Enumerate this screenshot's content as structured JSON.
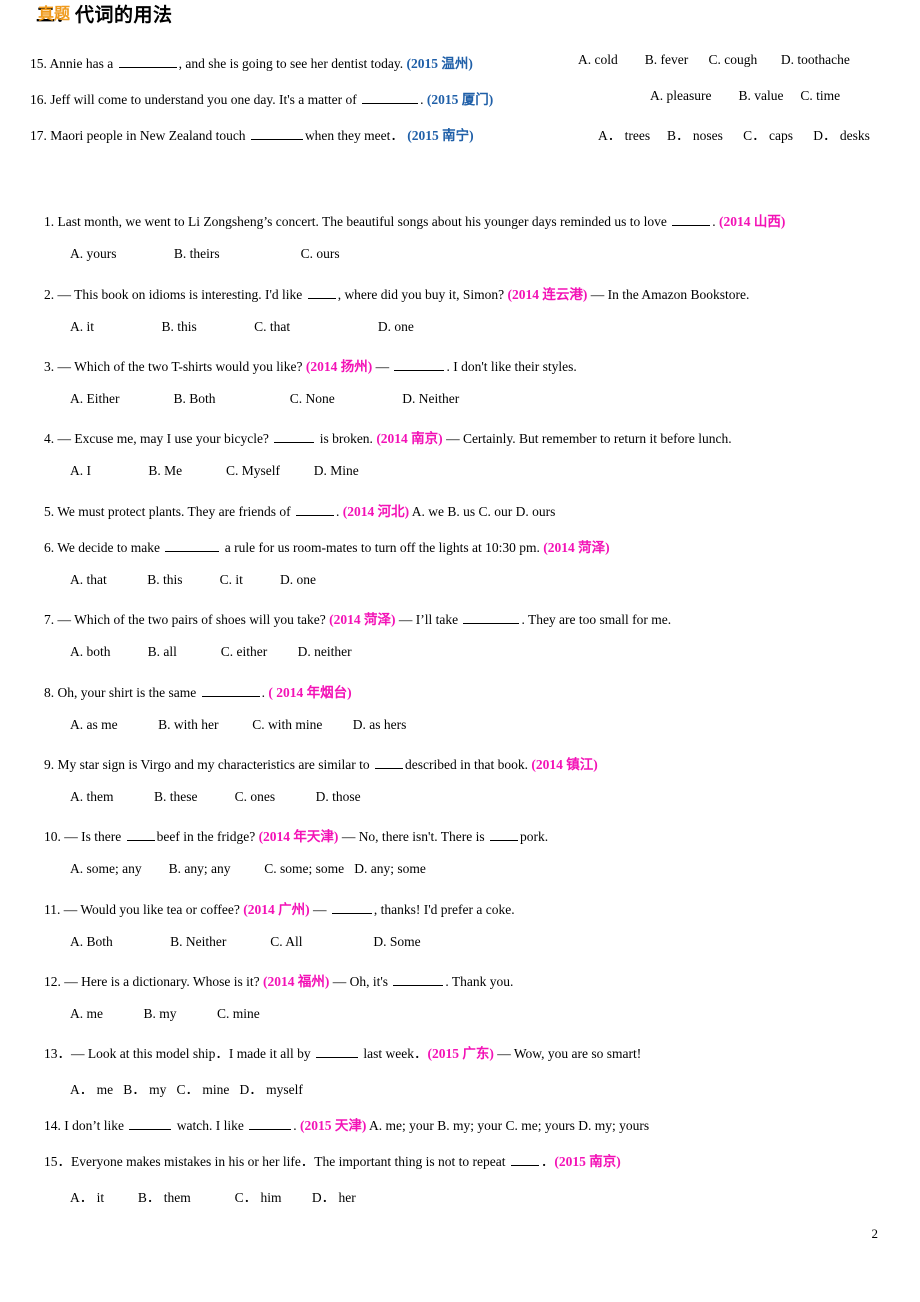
{
  "page": {
    "number": "2"
  },
  "top_section": {
    "items": [
      {
        "num": "15.",
        "stem_a": "Annie has a",
        "stem_b": ", and she is going to see her dentist today.",
        "tag": "(2015 温州)",
        "tag_color": "blue",
        "options": "A. cold        B. fever      C. cough       D. toothache",
        "blank_w": "58"
      },
      {
        "num": "16.",
        "stem_a": "Jeff will come to understand you one day. It's a matter of",
        "stem_b": ".",
        "tag": "(2015 厦门)",
        "tag_color": "blue",
        "options": "A. pleasure        B. value     C. time",
        "blank_w": "56"
      },
      {
        "num": "17.",
        "stem_a": " Maori people in New Zealand touch",
        "stem_b": "when they meet．",
        "tag": "(2015 南宁)",
        "tag_color": "blue",
        "options": "A． trees     B． noses      C． caps      D． desks",
        "blank_w": "52"
      }
    ]
  },
  "section": {
    "title": "二．代词的用法",
    "subtitle": "真题"
  },
  "questions": [
    {
      "id": "q1",
      "stem": [
        {
          "t": "1. Last month, we went to Li Zongsheng’s concert. The beautiful songs about his younger days reminded us to love "
        },
        {
          "blank": "38"
        },
        {
          "t": ". "
        },
        {
          "tag": "(2014  山西)",
          "color": "pink"
        }
      ],
      "options": "A. yours                 B. theirs                        C. ours"
    },
    {
      "id": "q2",
      "stem": [
        {
          "t": "2. — This book on idioms is interesting. I'd like "
        },
        {
          "blank": "28"
        },
        {
          "t": ", where did you buy it, Simon? "
        },
        {
          "tag": "(2014 连云港)",
          "color": "pink"
        },
        {
          "t": "        — In the Amazon Bookstore."
        }
      ],
      "options": "A. it                    B. this                 C. that                          D. one"
    },
    {
      "id": "q3",
      "stem": [
        {
          "t": "3. — Which of the two T-shirts would you like? "
        },
        {
          "tag": "(2014 扬州)",
          "color": "pink"
        },
        {
          "t": "      — "
        },
        {
          "blank": "50"
        },
        {
          "t": ". I don't like their styles."
        }
      ],
      "options": "A. Either                B. Both                      C. None                    D. Neither"
    },
    {
      "id": "q4",
      "stem": [
        {
          "t": "4. — Excuse me, may I use your bicycle? "
        },
        {
          "blank": "40"
        },
        {
          "t": " is broken. "
        },
        {
          "tag": "(2014 南京)",
          "color": "pink"
        },
        {
          "t": "     — Certainly. But remember to return it before lunch."
        }
      ],
      "options": "A. I                 B. Me             C. Myself          D. Mine"
    },
    {
      "id": "q5",
      "stem": [
        {
          "t": "5. We must protect plants. They are friends of "
        },
        {
          "blank": "38"
        },
        {
          "t": ". "
        },
        {
          "tag": "(2014 河北)",
          "color": "pink"
        },
        {
          "t": "     A. we        B. us         C. our        D. ours"
        }
      ],
      "options": ""
    },
    {
      "id": "q6",
      "stem": [
        {
          "t": "6. We decide to make "
        },
        {
          "blank": "54"
        },
        {
          "t": " a rule for us room-mates to turn off the lights at 10:30 pm. "
        },
        {
          "tag": "(2014  菏泽)",
          "color": "pink"
        }
      ],
      "options": "A. that            B. this           C. it           D. one"
    },
    {
      "id": "q7",
      "stem": [
        {
          "t": "7. — Which of the two pairs of shoes will you take? "
        },
        {
          "tag": "(2014  菏泽)",
          "color": "pink"
        },
        {
          "t": "    — I’ll take "
        },
        {
          "blank": "56"
        },
        {
          "t": ". They are too small for me."
        }
      ],
      "options": "A. both           B. all             C. either         D. neither"
    },
    {
      "id": "q8",
      "stem": [
        {
          "t": "8. Oh, your shirt is the same "
        },
        {
          "blank": "58"
        },
        {
          "t": ". "
        },
        {
          "tag": "( 2014 年烟台)",
          "color": "pink"
        }
      ],
      "options": "A. as me            B. with her          C. with mine         D. as hers"
    },
    {
      "id": "q9",
      "stem": [
        {
          "t": "9. My star sign is Virgo and my characteristics are similar to "
        },
        {
          "blank": "28"
        },
        {
          "t": "described in that book. "
        },
        {
          "tag": "(2014 镇江)",
          "color": "pink"
        }
      ],
      "options": "A. them            B. these           C. ones            D. those"
    },
    {
      "id": "q10",
      "stem": [
        {
          "t": "10. — Is there "
        },
        {
          "blank": "28"
        },
        {
          "t": "beef in the fridge? "
        },
        {
          "tag": "(2014 年天津)",
          "color": "pink"
        },
        {
          "t": "            — No, there isn't. There is "
        },
        {
          "blank": "28"
        },
        {
          "t": "pork."
        }
      ],
      "options": "A. some; any        B. any; any          C. some; some   D. any; some"
    },
    {
      "id": "q11",
      "stem": [
        {
          "t": "11. — Would you like tea or coffee? "
        },
        {
          "tag": "(2014 广州)",
          "color": "pink"
        },
        {
          "t": "               — "
        },
        {
          "blank": "40"
        },
        {
          "t": ", thanks! I'd prefer a coke."
        }
      ],
      "options": "A. Both                 B. Neither             C. All                     D. Some"
    },
    {
      "id": "q12",
      "stem": [
        {
          "t": "12. — Here is a dictionary. Whose is it? "
        },
        {
          "tag": "(2014 福州)",
          "color": "pink"
        },
        {
          "t": "   — Oh, it's "
        },
        {
          "blank": "50"
        },
        {
          "t": ". Thank you."
        }
      ],
      "options": "A. me            B. my            C. mine"
    },
    {
      "id": "q13",
      "stem": [
        {
          "t": "13．— Look at this model ship．I made it all by "
        },
        {
          "blank": "42"
        },
        {
          "t": " last week．"
        },
        {
          "tag": "(2015 广东)",
          "color": "pink"
        },
        {
          "t": "   — Wow, you are so smart!"
        }
      ],
      "options": "A． me   B． my   C． mine   D． myself"
    },
    {
      "id": "q14",
      "stem": [
        {
          "t": "14. I don’t like "
        },
        {
          "blank": "42"
        },
        {
          "t": " watch. I like "
        },
        {
          "blank": "42"
        },
        {
          "t": ". "
        },
        {
          "tag": "(2015 天津)",
          "color": "pink"
        },
        {
          "t": "      A. me; your       B. my; your        C. me; yours    D. my; yours"
        }
      ],
      "options": ""
    },
    {
      "id": "q15",
      "stem": [
        {
          "t": "15．Everyone makes mistakes in his or her life．The important thing is not to repeat "
        },
        {
          "blank": "28"
        },
        {
          "t": "．"
        },
        {
          "tag": "(2015 南京)",
          "color": "pink"
        }
      ],
      "options": "A． it          B． them             C． him         D． her"
    }
  ],
  "layout": {
    "top_rows_y": [
      "52",
      "88",
      "124"
    ],
    "top_opts_x": [
      "548",
      "620",
      "568"
    ],
    "section_title_y": "158",
    "section_sub_y": "180",
    "q_y": [
      "210",
      "283",
      "355",
      "427",
      "500",
      "536",
      "608",
      "681",
      "753",
      "825",
      "898",
      "970",
      "1042",
      "1114",
      "1150"
    ],
    "o_y": [
      "246",
      "319",
      "391",
      "463",
      "",
      "572",
      "644",
      "717",
      "789",
      "861",
      "934",
      "1006",
      "1078",
      "",
      "1186"
    ]
  }
}
